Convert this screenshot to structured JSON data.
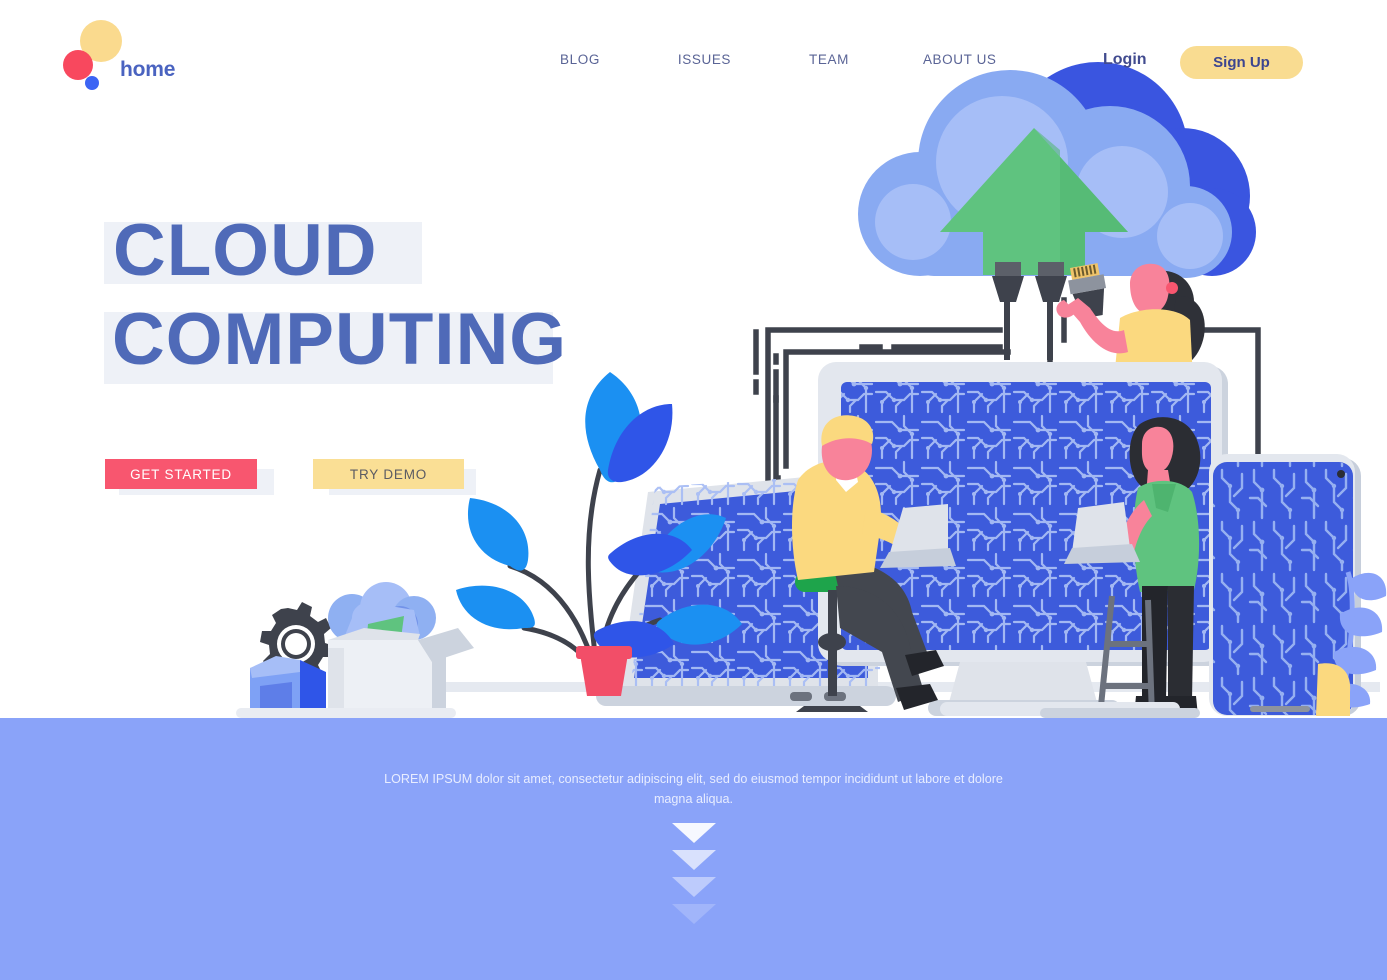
{
  "brand": {
    "name": "home",
    "dots": [
      {
        "name": "yellow-dot",
        "color": "#fada8e"
      },
      {
        "name": "red-dot",
        "color": "#f8485e"
      },
      {
        "name": "blue-dot",
        "color": "#3c64f4"
      }
    ]
  },
  "nav": {
    "items": [
      {
        "label": "BLOG"
      },
      {
        "label": "ISSUES"
      },
      {
        "label": "TEAM"
      },
      {
        "label": "ABOUT US"
      }
    ],
    "login_label": "Login",
    "signup_label": "Sign Up"
  },
  "hero": {
    "headline_line1": "CLOUD",
    "headline_line2": "COMPUTING",
    "cta_primary": "GET STARTED",
    "cta_secondary": "TRY DEMO"
  },
  "footer": {
    "paragraph": "LOREM IPSUM dolor sit amet, consectetur adipiscing elit, sed do eiusmod tempor incididunt ut labore et dolore magna aliqua.",
    "scroll_hint_arrows": 4
  },
  "illustration": {
    "theme": "cloud-computing",
    "elements": [
      "cloud",
      "upload-arrow",
      "ethernet-plugs",
      "woman-with-cable",
      "desktop-monitor",
      "laptop",
      "tablet",
      "man-on-stool-with-laptop",
      "woman-standing-with-laptop",
      "potted-plant",
      "open-boxes",
      "gear"
    ]
  },
  "colors": {
    "accent_pink": "#f8566f",
    "accent_yellow": "#fadf95",
    "brand_blue": "#4f6ab8",
    "panel_blue": "#8aa3f9",
    "highlight_gray": "#eef1f7",
    "screen_blue": "#3d5bdb",
    "cloud_blue": "#8fb0f2",
    "cloud_blue_dark": "#3a55e0",
    "green": "#5fc37f",
    "skin": "#f8839a",
    "dark": "#3a3d47"
  }
}
